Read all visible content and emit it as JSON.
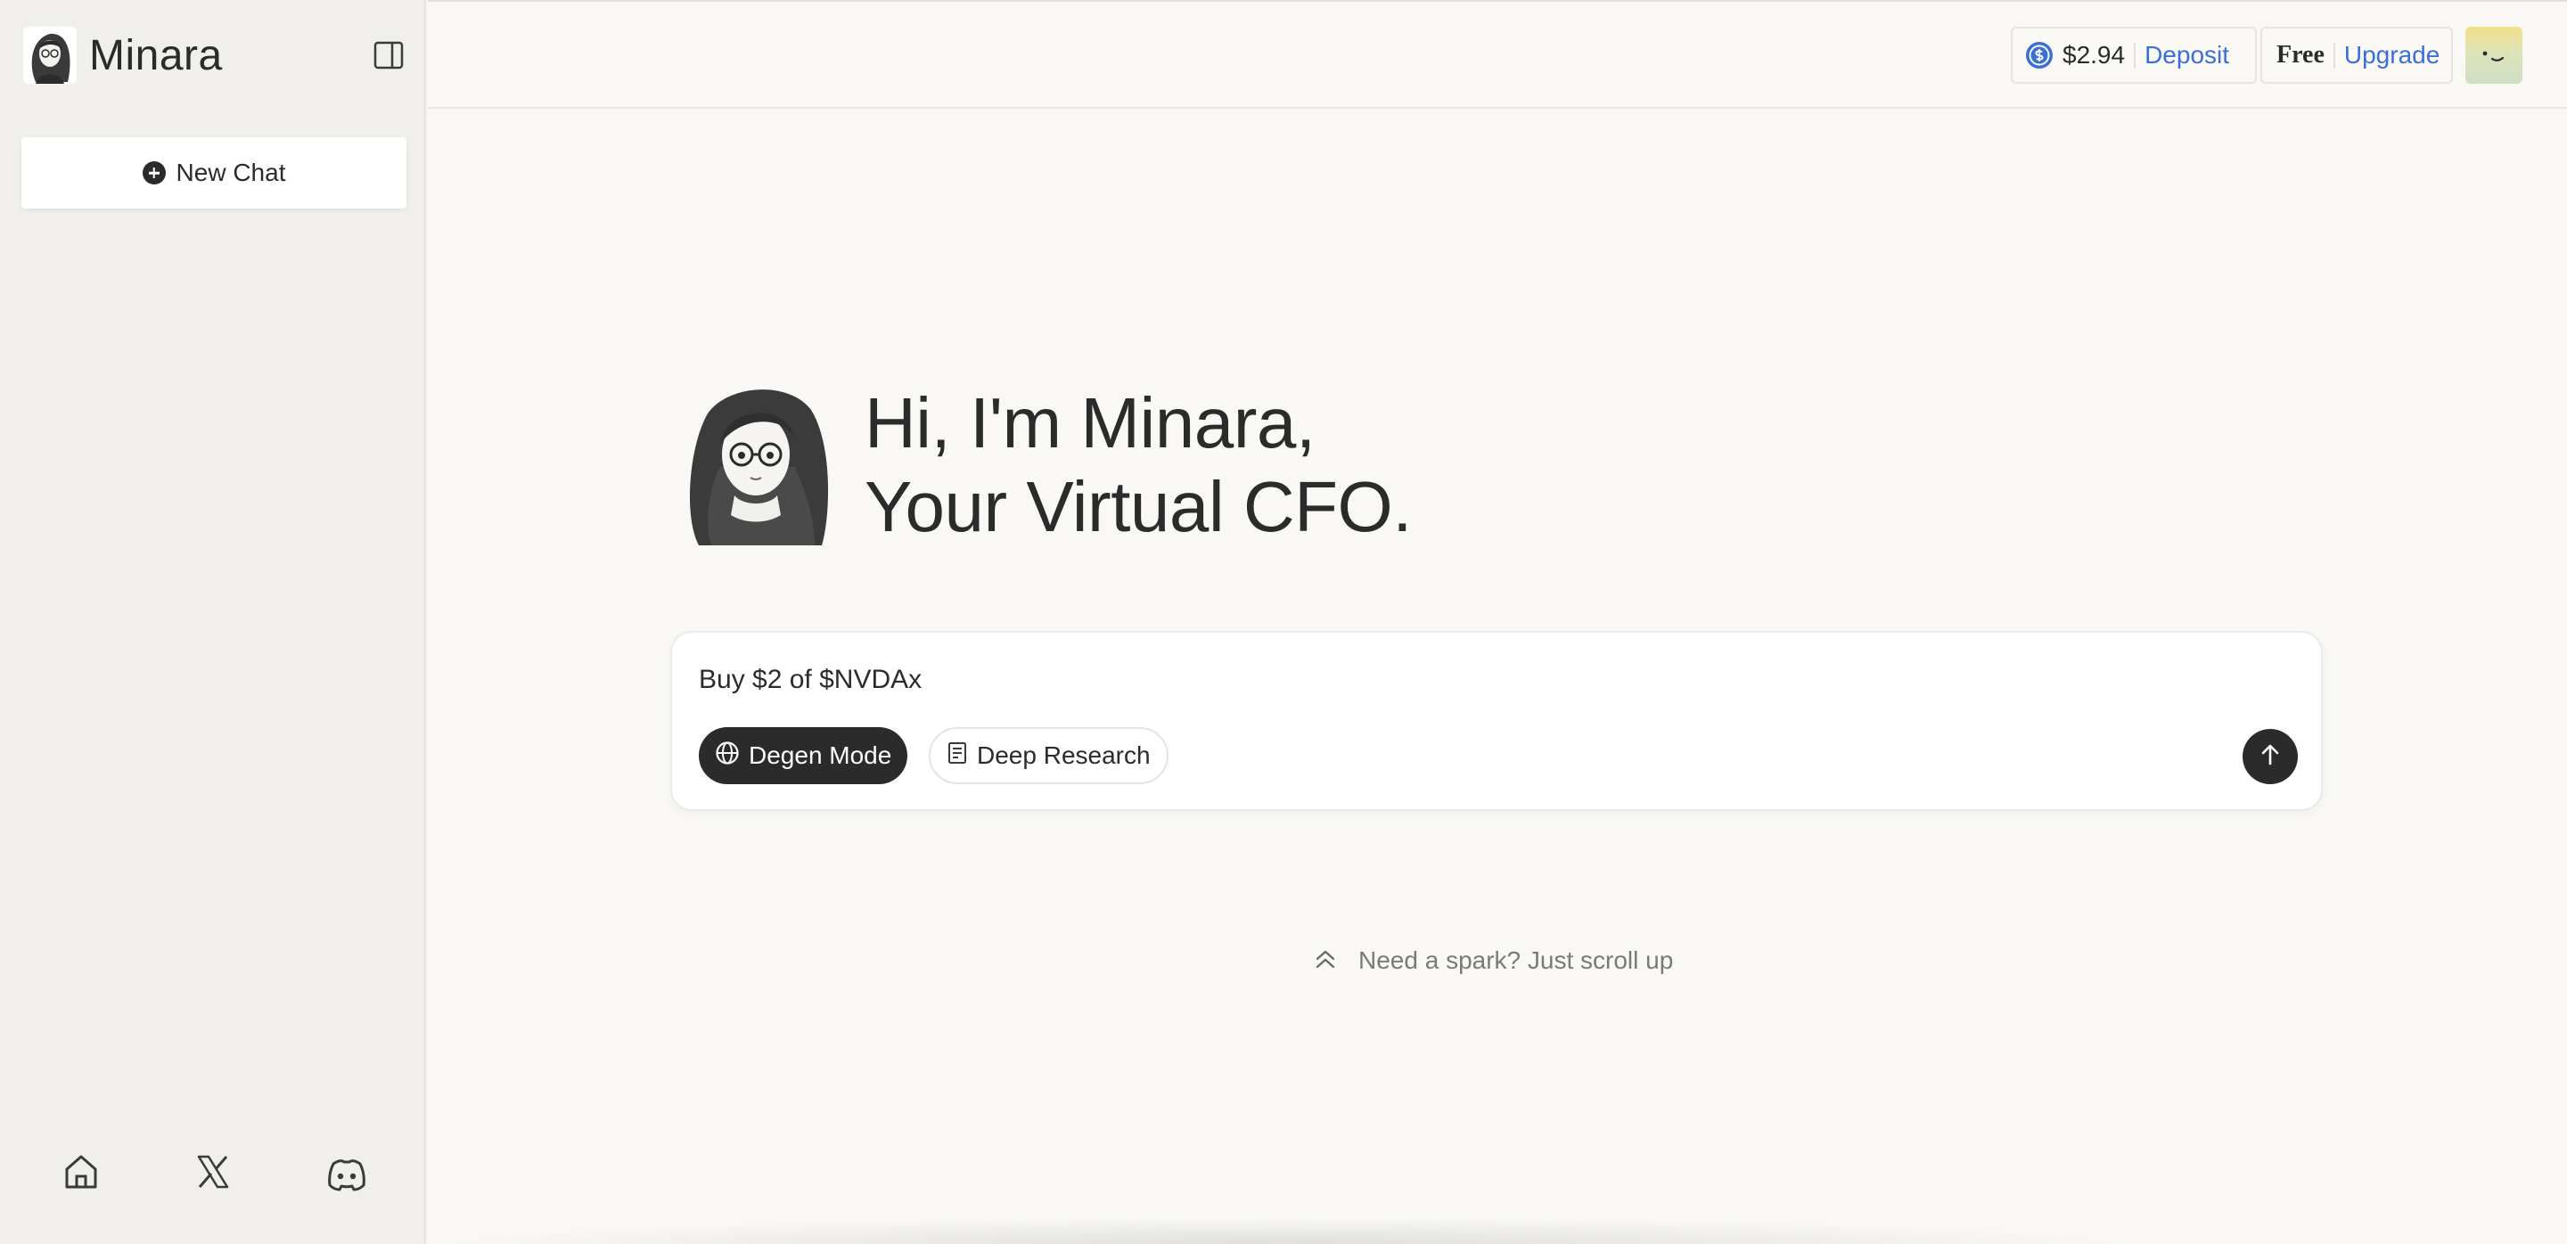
{
  "sidebar": {
    "brand_name": "Minara",
    "new_chat_label": "New Chat",
    "footer_icons": [
      "home-icon",
      "x-logo-icon",
      "discord-icon"
    ]
  },
  "topbar": {
    "balance": "$2.94",
    "deposit_label": "Deposit",
    "plan_label": "Free",
    "upgrade_label": "Upgrade"
  },
  "hero": {
    "line1": "Hi, I'm Minara,",
    "line2": "Your Virtual CFO."
  },
  "composer": {
    "input_value": "Buy $2 of $NVDAx",
    "degen_label": "Degen Mode",
    "deep_label": "Deep Research"
  },
  "hint": {
    "text": "Need a spark? Just scroll up"
  },
  "colors": {
    "accent_blue": "#3b6fd8",
    "dark": "#2b2b2b",
    "sidebar_bg": "#f0efeb",
    "page_bg": "#f9f8f5"
  }
}
